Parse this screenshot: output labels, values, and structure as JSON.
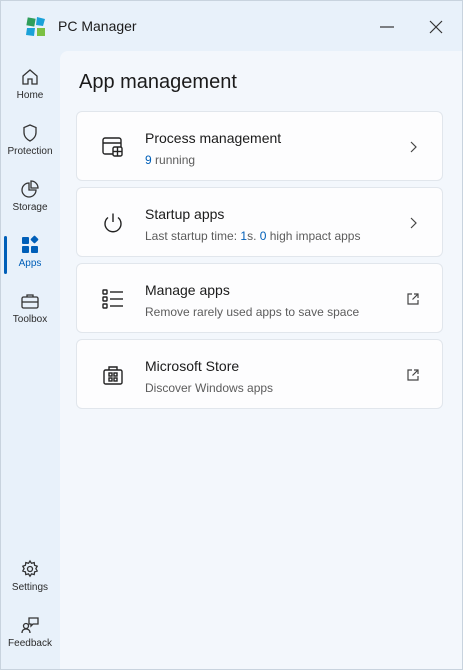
{
  "app": {
    "title": "PC Manager"
  },
  "sidebar": {
    "items": [
      {
        "label": "Home",
        "icon": "home-icon"
      },
      {
        "label": "Protection",
        "icon": "shield-icon"
      },
      {
        "label": "Storage",
        "icon": "pie-chart-icon"
      },
      {
        "label": "Apps",
        "icon": "apps-icon",
        "active": true
      },
      {
        "label": "Toolbox",
        "icon": "toolbox-icon"
      }
    ],
    "bottom": [
      {
        "label": "Settings",
        "icon": "gear-icon"
      },
      {
        "label": "Feedback",
        "icon": "feedback-icon"
      }
    ]
  },
  "main": {
    "title": "App management",
    "cards": [
      {
        "title": "Process management",
        "subtitle": {
          "count": "9",
          "text": " running"
        }
      },
      {
        "title": "Startup apps",
        "subtitle": {
          "prefix": "Last startup time: ",
          "time": "1",
          "mid": "s. ",
          "count": "0",
          "suffix": " high impact apps"
        }
      },
      {
        "title": "Manage apps",
        "subtitle": {
          "text": "Remove rarely used apps to save space"
        }
      },
      {
        "title": "Microsoft Store",
        "subtitle": {
          "text": "Discover Windows apps"
        }
      }
    ]
  },
  "colors": {
    "accent": "#005fb8",
    "background": "#e8f1fa",
    "panel": "#f3f7fc",
    "card": "#fdfdfe"
  }
}
